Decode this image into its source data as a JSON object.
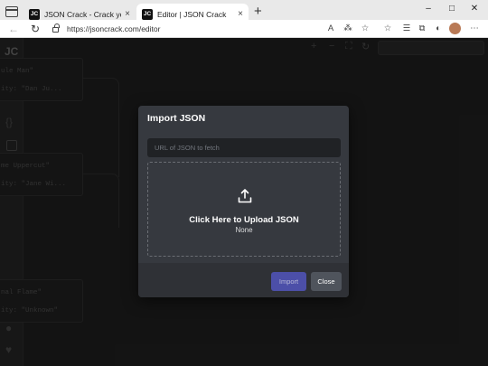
{
  "browser": {
    "tabs": [
      {
        "favicon": "JC",
        "title": "JSON Crack - Crack your data into pieces",
        "close": "×"
      },
      {
        "favicon": "JC",
        "title": "Editor | JSON Crack",
        "close": "×"
      }
    ],
    "new_tab": "+",
    "window_controls": {
      "minimize": "–",
      "maximize": "□",
      "close": "✕"
    },
    "nav": {
      "back": "←",
      "reload": "↻"
    },
    "url": "https://jsoncrack.com/editor",
    "toolbar_icons": {
      "read_aloud": "A",
      "immersive_reader": "⁂",
      "tracking": "☆",
      "favorite": "☆",
      "favorites_bar": "☰",
      "collections": "⧉",
      "extensions": "◐",
      "more": "⋯"
    }
  },
  "app": {
    "logo": "JC",
    "topbar_icons": {
      "add": "+",
      "minus": "−",
      "fit": "⛶",
      "refresh": "↻"
    },
    "nodes": [
      {
        "line1": "ule Man\"",
        "line2": "ity: \"Dan Ju..."
      },
      {
        "line1": "me Uppercut\"",
        "line2": "ity: \"Jane Wi..."
      },
      {
        "line1": "nal Flame\"",
        "line2": "ity: \"Unknown\""
      }
    ]
  },
  "modal": {
    "title": "Import JSON",
    "url_placeholder": "URL of JSON to fetch",
    "upload_title": "Click Here to Upload JSON",
    "upload_file": "None",
    "import_label": "Import",
    "close_label": "Close"
  },
  "colors": {
    "modal_bg": "#36393f",
    "input_bg": "#202225",
    "import_button": "#4c4fa8",
    "close_button": "#4f545c"
  }
}
